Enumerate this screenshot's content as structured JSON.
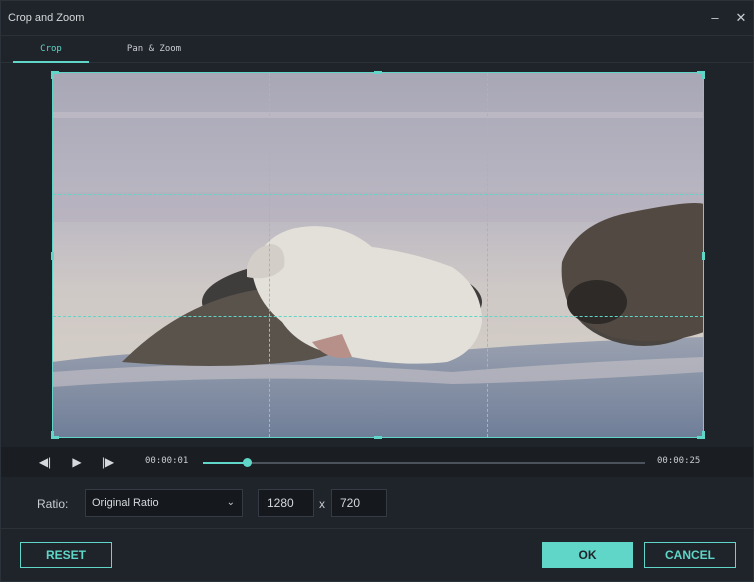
{
  "window": {
    "title": "Crop and Zoom",
    "minimize_glyph": "–",
    "close_glyph": "✕"
  },
  "tabs": [
    {
      "label": "Crop",
      "active": true
    },
    {
      "label": "Pan & Zoom",
      "active": false
    }
  ],
  "player": {
    "current_time": "00:00:01",
    "total_time": "00:00:25",
    "progress": 0.1,
    "prev_glyph": "◀|",
    "play_glyph": "▶",
    "next_glyph": "|▶"
  },
  "ratio": {
    "label": "Ratio:",
    "selected": "Original Ratio",
    "width": "1280",
    "separator": "x",
    "height": "720"
  },
  "buttons": {
    "reset": "RESET",
    "ok": "OK",
    "cancel": "CANCEL"
  },
  "colors": {
    "accent": "#5fd6c8",
    "background": "#1f242a"
  }
}
